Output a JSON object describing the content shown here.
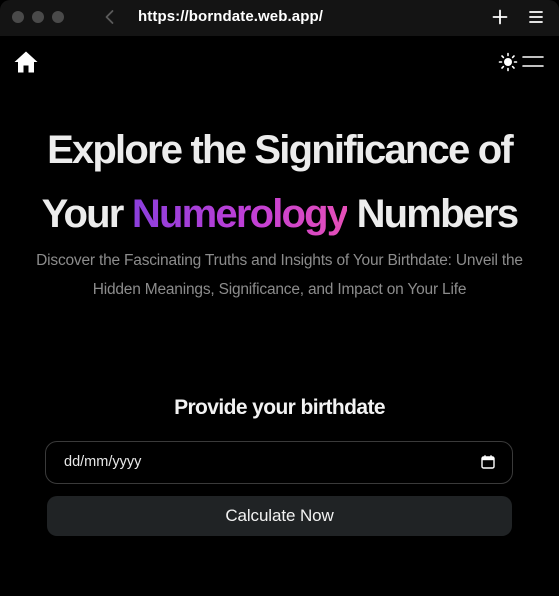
{
  "browser": {
    "url": "https://borndate.web.app/",
    "icons": {
      "back": "chevron-left-icon",
      "new_tab": "plus-icon",
      "menu": "hamburger-menu-icon"
    }
  },
  "site_header": {
    "home_icon": "home-icon",
    "theme_icon": "sun-icon",
    "menu_icon": "hamburger-menu-icon"
  },
  "hero": {
    "title_line1": "Explore the Significance of",
    "title_prefix": "Your ",
    "title_accent": "Numerology",
    "title_suffix": " Numbers",
    "subtitle": "Discover the Fascinating Truths and Insights of Your Birthdate: Unveil the Hidden Meanings, Significance, and Impact on Your Life"
  },
  "form": {
    "label": "Provide your birthdate",
    "date_placeholder": "dd/mm/yyyy",
    "date_icon": "calendar-icon",
    "submit_label": "Calculate Now"
  },
  "colors": {
    "background": "#000000",
    "chrome": "#141414",
    "accent_gradient_start": "#8b3fdc",
    "accent_gradient_end": "#e64fb8",
    "subtitle_text": "#8c8c8c",
    "button_bg": "#202325"
  }
}
